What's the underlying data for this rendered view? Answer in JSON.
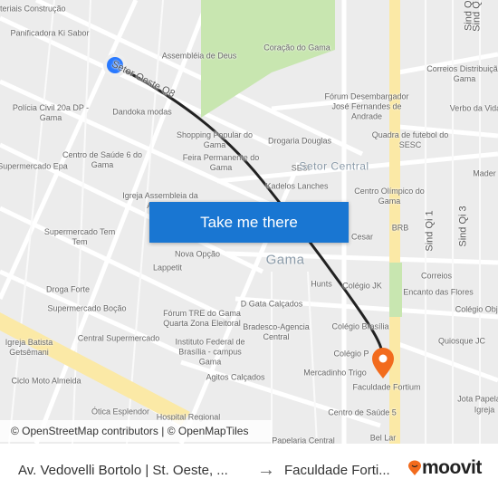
{
  "map": {
    "labels": [
      "Materiais Construção",
      "Panificadora Ki Sabor",
      "Assembléia de Deus",
      "Coração do Gama",
      "Sind Q",
      "Sind Qi",
      "Correios Distribuição Gama",
      "Fórum Desembargador José Fernandes de Andrade",
      "Verbo da Vida",
      "Dandoka modas",
      "Polícia Civil 20a DP - Gama",
      "Shopping Popular do Gama",
      "Drogaria Douglas",
      "Quadra de futebol do SESC",
      "Feira Permanente do Gama",
      "Centro de Saúde 6 do Gama",
      "Supermercado Epa",
      "SESI",
      "Mader",
      "Kadelos Lanches",
      "Centro Olímpico do Gama",
      "Igreja Assembleia da Aliança",
      "BRB",
      "Sind Qi 1",
      "Sind Qi 3",
      "Supermercado Tem Tem",
      "m Cesar",
      "Nova Opção",
      "Lappetit",
      "Correios",
      "Hunts",
      "Colégio JK",
      "Encanto das Flores",
      "Droga Forte",
      "Supermercado Boção",
      "Fórum TRE do Gama Quarta Zona Eleitoral",
      "D Gata Calçados",
      "Colégio Objet",
      "Bradesco-Agencia Central",
      "Colégio Brasília",
      "Quiosque JC",
      "Igreja Batista Getsêmani",
      "Central Supermercado",
      "Instituto Federal de Brasília - campus Gama",
      "Colégio P",
      "Mercadinho Trigo",
      "Ciclo Moto Almeida",
      "Agitos Calçados",
      "Faculdade Fortium",
      "Jota Papela",
      "Igreja",
      "Ótica Esplendor",
      "Hospital Regional",
      "Centro de Saúde 5",
      "Papelaria Central",
      "Bel Lar"
    ],
    "road_label": "Setor Oeste Q8",
    "district_labels": [
      "Setor Central",
      "Gama"
    ],
    "origin_color": "#2979ff",
    "destination_color": "#f26b1d",
    "route_color": "#222222",
    "park_color": "#c8e6b0"
  },
  "cta": {
    "label": "Take me there"
  },
  "attribution": "© OpenStreetMap contributors | © OpenMapTiles",
  "footer": {
    "origin": "Av. Vedovelli Bortolo | St. Oeste, ...",
    "arrow": "→",
    "destination": "Faculdade Forti...",
    "brand": "moovit"
  }
}
